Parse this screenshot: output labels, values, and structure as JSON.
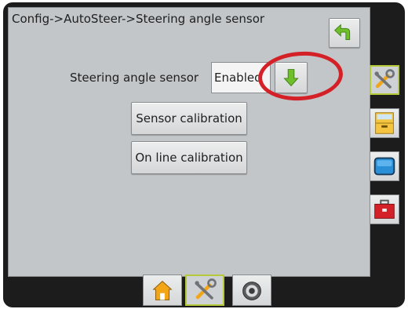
{
  "header": {
    "breadcrumb": "Config->AutoSteer->Steering angle sensor"
  },
  "settings": {
    "steering_angle_sensor": {
      "label": "Steering angle sensor",
      "value": "Enabled"
    },
    "sensor_calibration_label": "Sensor calibration",
    "online_calibration_label": "On line calibration"
  },
  "icons": {
    "back": "back-arrow-icon",
    "dropdown": "green-down-arrow-icon",
    "side_tabs": [
      "tools-icon",
      "cabinet-icon",
      "screen-icon",
      "toolbox-icon"
    ],
    "bottom_tabs": [
      "home-icon",
      "tools-icon",
      "gauge-icon"
    ]
  },
  "colors": {
    "highlight_ring": "#d42027",
    "active_tab_border": "#b5c93a",
    "arrow_green": "#6fbf2b"
  }
}
